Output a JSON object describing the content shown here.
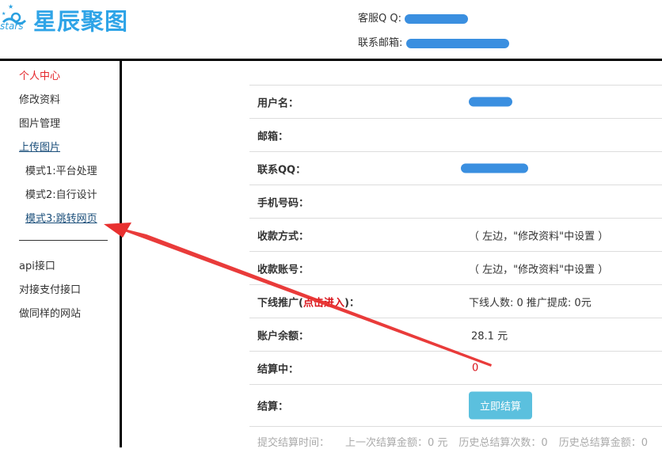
{
  "header": {
    "logo_text": "星辰聚图",
    "logo_sub": "stars",
    "qq_label": "客服Q Q:",
    "email_label": "联系邮箱:"
  },
  "sidebar": {
    "items": [
      {
        "label": "个人中心"
      },
      {
        "label": "修改资料"
      },
      {
        "label": "图片管理"
      },
      {
        "label": "上传图片"
      },
      {
        "label": "模式1:平台处理"
      },
      {
        "label": "模式2:自行设计"
      },
      {
        "label": "模式3:跳转网页"
      },
      {
        "label": "api接口"
      },
      {
        "label": "对接支付接口"
      },
      {
        "label": "做同样的网站"
      }
    ]
  },
  "table": {
    "rows": [
      {
        "label": "用户名："
      },
      {
        "label": "邮箱："
      },
      {
        "label": "联系QQ："
      },
      {
        "label": "手机号码："
      },
      {
        "label": "收款方式：",
        "value": "（ 左边，\"修改资料\"中设置 ）"
      },
      {
        "label": "收款账号：",
        "value": "（ 左边，\"修改资料\"中设置 ）"
      },
      {
        "label_pre": "下线推广(",
        "label_link": "点击进入",
        "label_post": ")：",
        "value": "下线人数: 0  推广提成: 0元"
      },
      {
        "label": "账户余额：",
        "value": "28.1  元"
      },
      {
        "label": "结算中：",
        "value": "0"
      },
      {
        "label": "结算：",
        "button": "立即结算"
      }
    ]
  },
  "footer": {
    "submit_time": "提交结算时间：",
    "last_amount": "上一次结算金额：0 元",
    "total_count": "历史总结算次数：0",
    "total_amount": "历史总结算金额：0"
  }
}
